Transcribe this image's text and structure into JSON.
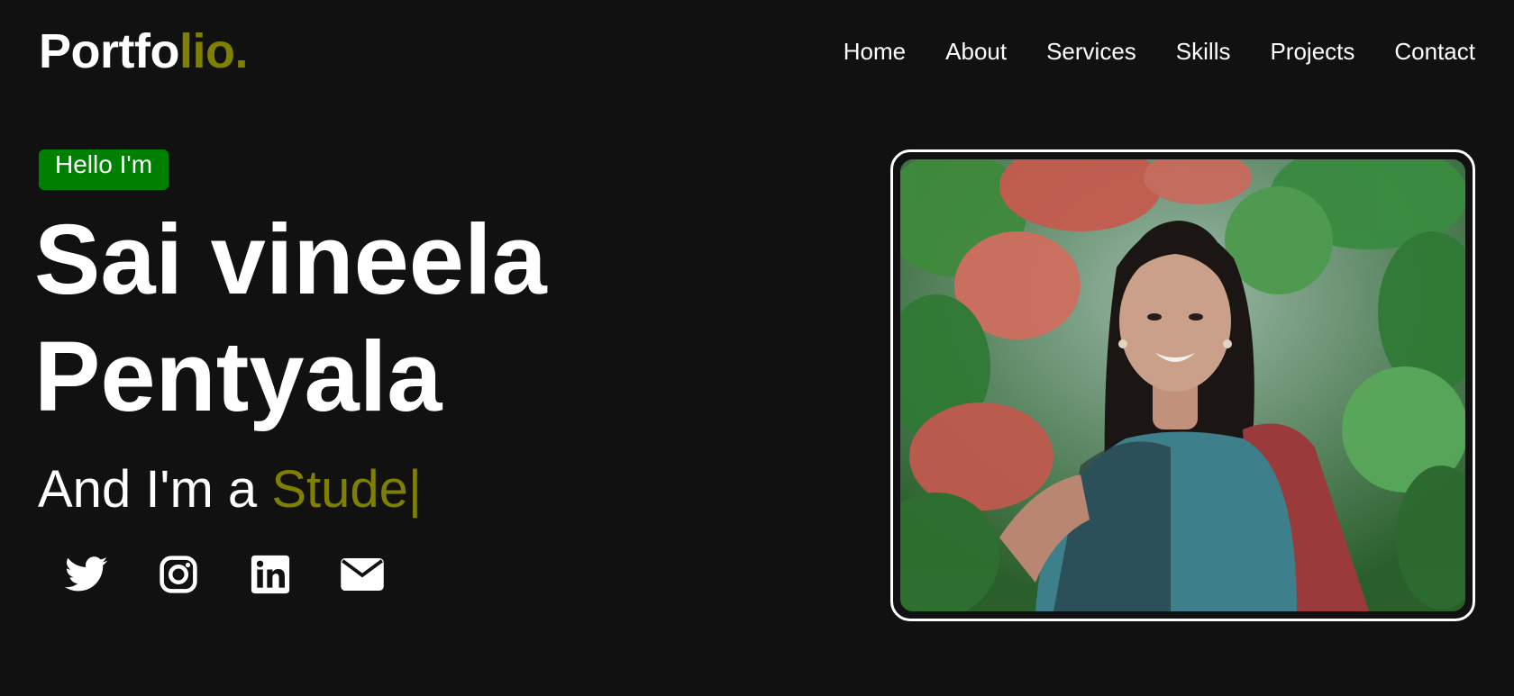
{
  "header": {
    "logo_main": "Portfo",
    "logo_accent": "lio.",
    "nav": [
      {
        "label": "Home"
      },
      {
        "label": "About"
      },
      {
        "label": "Services"
      },
      {
        "label": "Skills"
      },
      {
        "label": "Projects"
      },
      {
        "label": "Contact"
      }
    ]
  },
  "hero": {
    "greeting": "Hello I'm",
    "name_line1": "Sai vineela",
    "name_line2": "Pentyala",
    "role_prefix": "And I'm a ",
    "role_typed": "Stude",
    "role_cursor": "|",
    "socials": [
      {
        "icon": "twitter-icon"
      },
      {
        "icon": "instagram-icon"
      },
      {
        "icon": "linkedin-icon"
      },
      {
        "icon": "email-icon"
      }
    ]
  },
  "colors": {
    "background": "#111111",
    "accent": "#808000",
    "badge": "#008000",
    "text": "#ffffff"
  }
}
